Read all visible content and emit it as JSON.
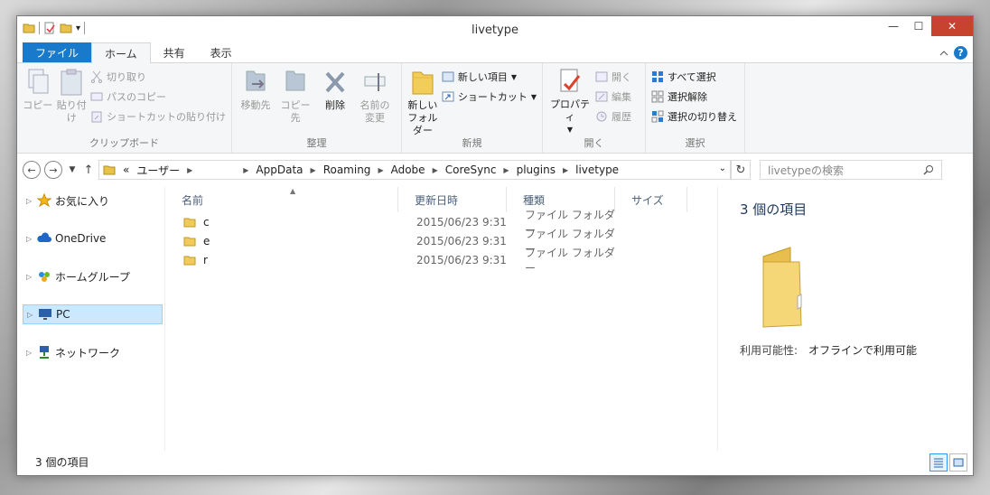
{
  "window": {
    "title": "livetype",
    "qat_dropdown": "▾",
    "controls": {
      "minimize": "—",
      "maximize": "☐",
      "close": "✕"
    }
  },
  "ribbon_tabs": [
    {
      "label": "ファイル"
    },
    {
      "label": "ホーム"
    },
    {
      "label": "共有"
    },
    {
      "label": "表示"
    }
  ],
  "ribbon": {
    "clipboard": {
      "group_label": "クリップボード",
      "copy": "コピー",
      "paste": "貼り付け",
      "cut": "切り取り",
      "copy_path": "パスのコピー",
      "paste_shortcut": "ショートカットの貼り付け"
    },
    "organize": {
      "group_label": "整理",
      "move_to": "移動先",
      "copy_to": "コピー先",
      "delete": "削除",
      "rename_line1": "名前の",
      "rename_line2": "変更"
    },
    "new": {
      "group_label": "新規",
      "new_folder_line1": "新しい",
      "new_folder_line2": "フォルダー",
      "new_item": "新しい項目",
      "shortcut": "ショートカット"
    },
    "open": {
      "group_label": "開く",
      "properties": "プロパティ",
      "open": "開く",
      "edit": "編集",
      "history": "履歴"
    },
    "select": {
      "group_label": "選択",
      "select_all": "すべて選択",
      "select_none": "選択解除",
      "invert": "選択の切り替え"
    }
  },
  "address": {
    "overflow": "«",
    "crumbs": [
      "ユーザー",
      "AppData",
      "Roaming",
      "Adobe",
      "CoreSync",
      "plugins",
      "livetype"
    ],
    "search_placeholder": "livetypeの検索"
  },
  "nav_pane": [
    {
      "label": "お気に入り",
      "icon": "star-icon"
    },
    {
      "label": "OneDrive",
      "icon": "cloud-icon"
    },
    {
      "label": "ホームグループ",
      "icon": "homegroup-icon"
    },
    {
      "label": "PC",
      "icon": "pc-icon",
      "selected": true
    },
    {
      "label": "ネットワーク",
      "icon": "network-icon"
    }
  ],
  "columns": [
    "名前",
    "更新日時",
    "種類",
    "サイズ"
  ],
  "files": [
    {
      "name": "c",
      "modified": "2015/06/23 9:31",
      "type": "ファイル フォルダー"
    },
    {
      "name": "e",
      "modified": "2015/06/23 9:31",
      "type": "ファイル フォルダー"
    },
    {
      "name": "r",
      "modified": "2015/06/23 9:31",
      "type": "ファイル フォルダー"
    }
  ],
  "preview": {
    "count": "3 個の項目",
    "availability_label": "利用可能性:",
    "availability_value": "オフラインで利用可能"
  },
  "status": {
    "count": "3 個の項目"
  },
  "colors": {
    "accent": "#1979ca",
    "close": "#c7432f",
    "selected": "#cce8ff"
  }
}
